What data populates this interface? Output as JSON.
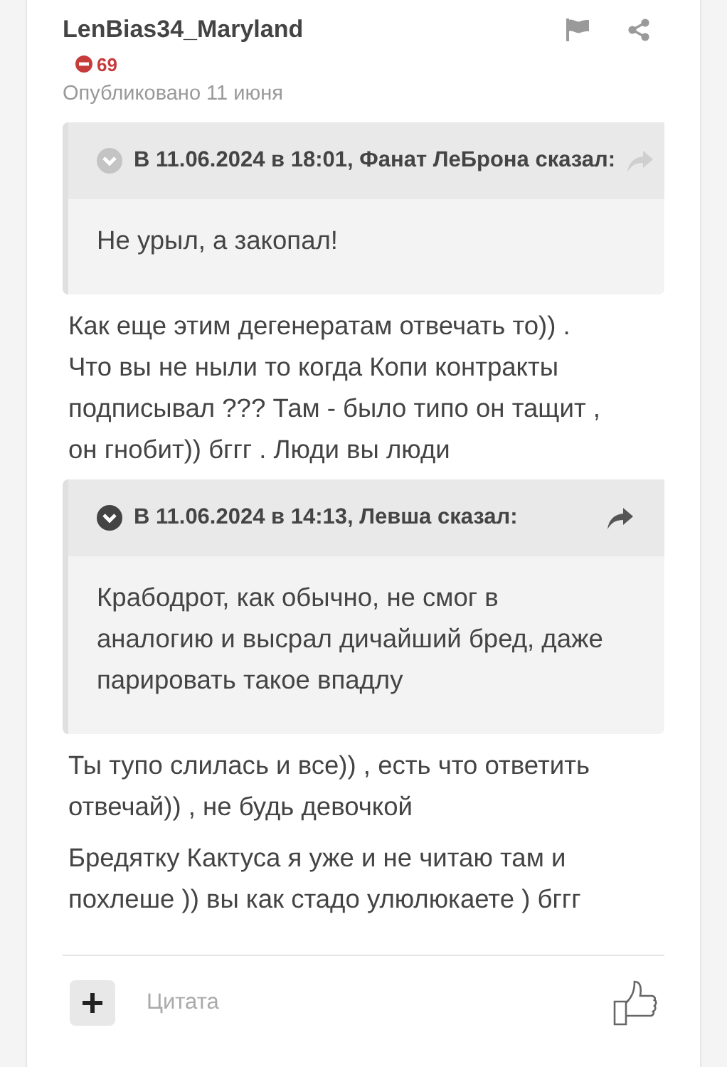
{
  "post": {
    "author": "LenBias34_Maryland",
    "reputation": "69",
    "published": "Опубликовано 11 июня",
    "content": [
      {
        "kind": "quote",
        "faded": true,
        "header": "В 11.06.2024 в 18:01, Фанат ЛеБрона сказал:",
        "body": "Не урыл, а закопал!"
      },
      {
        "kind": "text",
        "text": "Как еще этим дегенератам отвечать то)) . Что вы не ныли то когда Копи контракты подписывал ??? Там - было типо он тащит , он гнобит)) бггг . Люди вы люди"
      },
      {
        "kind": "quote",
        "faded": false,
        "header": "В 11.06.2024 в 14:13, Левша сказал:",
        "body": "Крабодрот, как обычно, не смог в аналогию и высрал дичайший бред, даже парировать такое впадлу"
      },
      {
        "kind": "text",
        "text": "Ты тупо слилась и все)) , есть что ответить отвечай)) , не будь девочкой"
      },
      {
        "kind": "text",
        "text": "Бредятку Кактуса я уже и не читаю там и похлеше )) вы как стадо улюлюкаете ) бггг"
      }
    ],
    "quote_button": "Цитата"
  }
}
